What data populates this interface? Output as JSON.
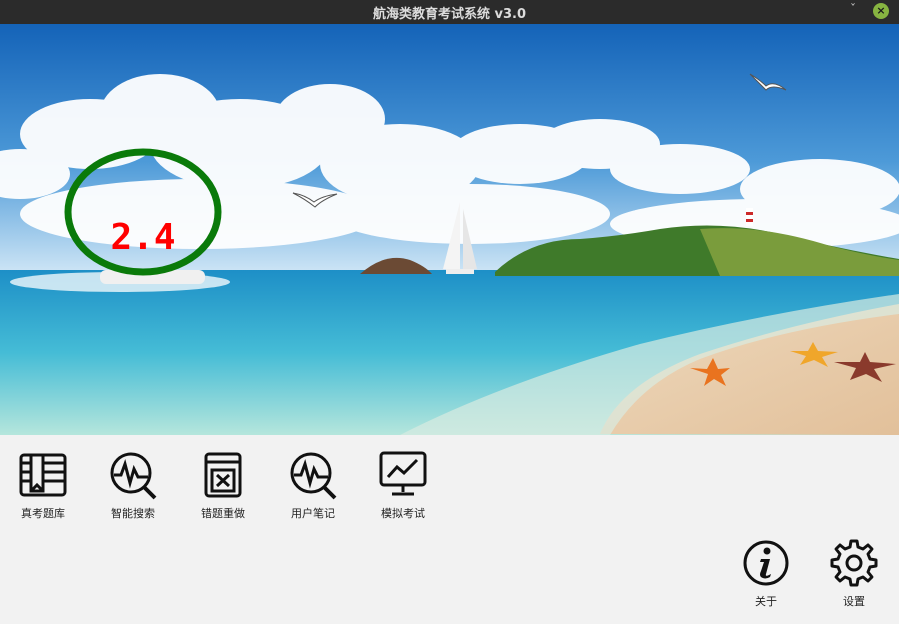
{
  "window": {
    "title": "航海类教育考试系统 v3.0",
    "minimize_glyph": "ˇ",
    "close_glyph": "×"
  },
  "banner": {
    "version": "2.4",
    "ring_color": "#0a7a0a",
    "text_color": "#ff0000"
  },
  "toolbar": {
    "items": [
      {
        "label": "真考题库",
        "icon": "book-icon"
      },
      {
        "label": "智能搜索",
        "icon": "search-chart-icon"
      },
      {
        "label": "错题重做",
        "icon": "wrong-questions-icon"
      },
      {
        "label": "用户笔记",
        "icon": "notes-search-icon"
      },
      {
        "label": "模拟考试",
        "icon": "monitor-chart-icon"
      }
    ]
  },
  "footer": {
    "about_label": "关于",
    "settings_label": "设置"
  }
}
